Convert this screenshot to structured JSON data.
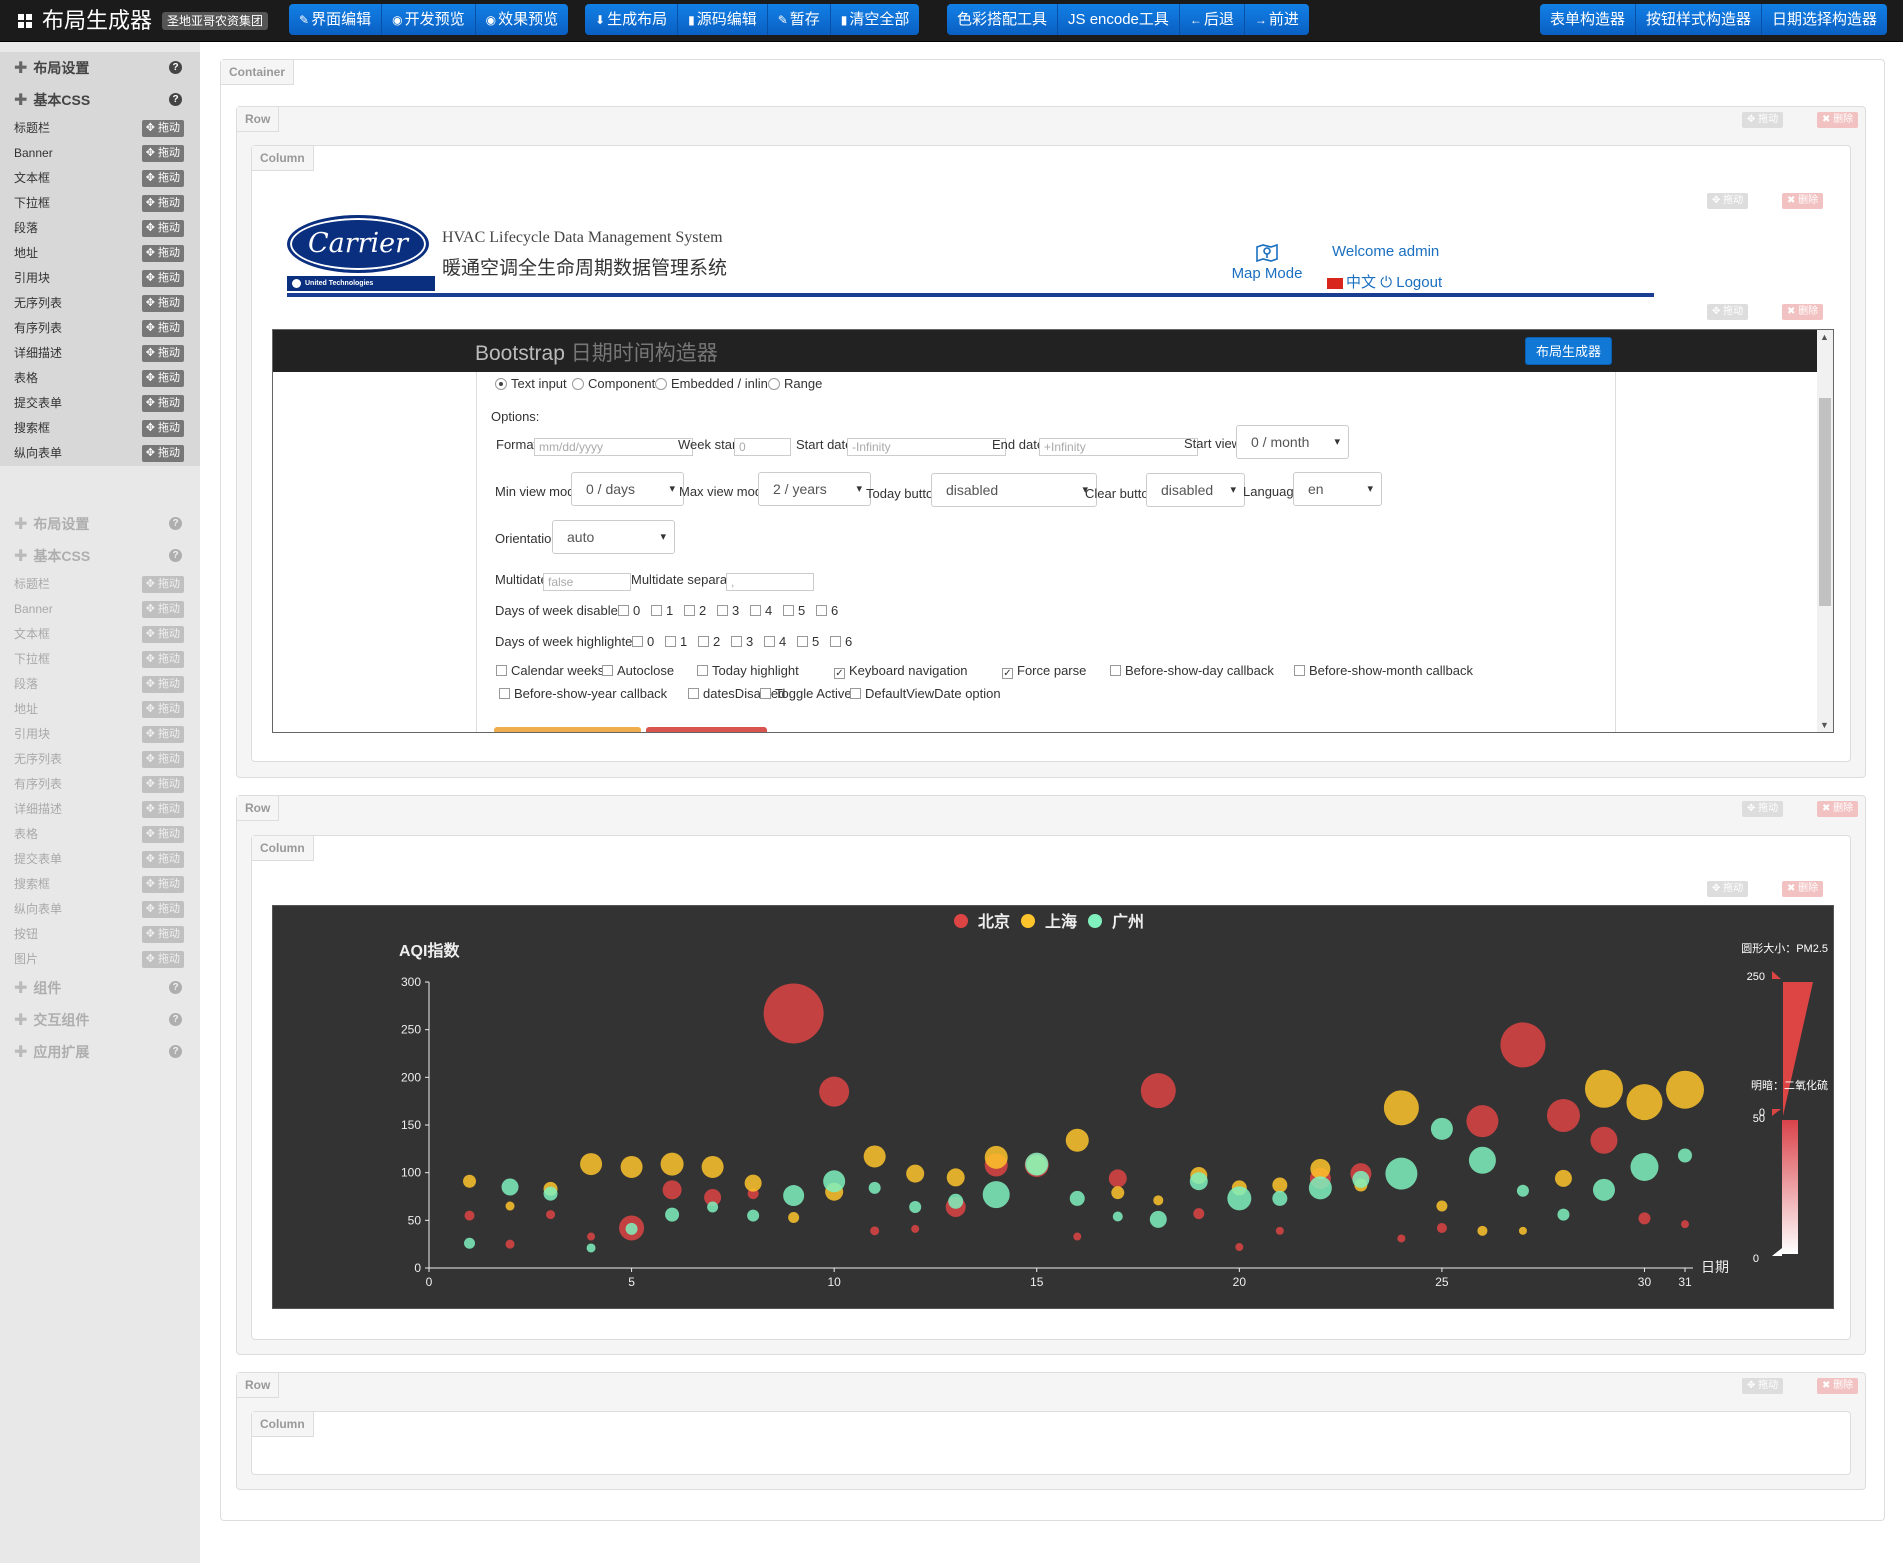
{
  "app": {
    "brand": "布局生成器",
    "brand_tag": "圣地亚哥农资集团"
  },
  "toolbar": {
    "group1": [
      {
        "icon": "edit-icon",
        "glyph": "✎",
        "label": "界面编辑"
      },
      {
        "icon": "eye-icon",
        "glyph": "◉",
        "label": "开发预览"
      },
      {
        "icon": "eye-icon",
        "glyph": "◉",
        "label": "效果预览"
      }
    ],
    "group2": [
      {
        "icon": "download-icon",
        "glyph": "⬇",
        "label": "生成布局"
      },
      {
        "icon": "file-icon",
        "glyph": "▮",
        "label": "源码编辑"
      },
      {
        "icon": "edit-icon",
        "glyph": "✎",
        "label": "暂存"
      },
      {
        "icon": "trash-icon",
        "glyph": "▮",
        "label": "清空全部"
      }
    ],
    "group3": [
      {
        "icon": "",
        "glyph": "",
        "label": "色彩搭配工具"
      },
      {
        "icon": "",
        "glyph": "",
        "label": "JS encode工具"
      },
      {
        "icon": "arrow-left-icon",
        "glyph": "←",
        "label": "后退"
      },
      {
        "icon": "arrow-right-icon",
        "glyph": "→",
        "label": "前进"
      }
    ],
    "group4": [
      {
        "icon": "",
        "glyph": "",
        "label": "表单构造器"
      },
      {
        "icon": "",
        "glyph": "",
        "label": "按钮样式构造器"
      },
      {
        "icon": "",
        "glyph": "",
        "label": "日期选择构造器"
      }
    ]
  },
  "sidebar": {
    "sections": [
      "布局设置",
      "基本CSS"
    ],
    "drag_label": "拖动",
    "items": [
      "标题栏",
      "Banner",
      "文本框",
      "下拉框",
      "段落",
      "地址",
      "引用块",
      "无序列表",
      "有序列表",
      "详细描述",
      "表格",
      "提交表单",
      "搜索框",
      "纵向表单"
    ],
    "ghost_items": [
      "标题栏",
      "Banner",
      "文本框",
      "下拉框",
      "段落",
      "地址",
      "引用块",
      "无序列表",
      "有序列表",
      "详细描述",
      "表格",
      "提交表单",
      "搜索框",
      "纵向表单",
      "按钮",
      "图片"
    ],
    "ghost_sections_after": [
      "组件",
      "交互组件",
      "应用扩展"
    ]
  },
  "canvas": {
    "container_label": "Container",
    "row_label": "Row",
    "column_label": "Column",
    "drag_label": "拖动",
    "delete_label": "删除"
  },
  "carrier": {
    "logo_text": "Carrier",
    "logo_sub": "United Technologies",
    "system_en": "HVAC Lifecycle Data Management System",
    "system_zh": "暖通空调全生命周期数据管理系统",
    "map_mode": "Map Mode",
    "welcome": "Welcome admin",
    "lang": "中文",
    "logout": "Logout"
  },
  "datepicker": {
    "title": "Bootstrap",
    "title_sub": "日期时间构造器",
    "generator_button": "布局生成器",
    "modes": [
      {
        "label": "Text input",
        "checked": true
      },
      {
        "label": "Component",
        "checked": false
      },
      {
        "label": "Embedded / inline",
        "checked": false
      },
      {
        "label": "Range",
        "checked": false
      }
    ],
    "options_label": "Options:",
    "format": {
      "label": "Format",
      "placeholder": "mm/dd/yyyy"
    },
    "week_start": {
      "label": "Week start",
      "placeholder": "0"
    },
    "start_date": {
      "label": "Start date",
      "placeholder": "-Infinity"
    },
    "end_date": {
      "label": "End date",
      "placeholder": "+Infinity"
    },
    "start_view": {
      "label": "Start view",
      "value": "0 / month"
    },
    "min_view_mode": {
      "label": "Min view mode",
      "value": "0 / days"
    },
    "max_view_mode": {
      "label": "Max view mode",
      "value": "2 / years"
    },
    "today_button": {
      "label": "Today button",
      "value": "disabled"
    },
    "clear_button": {
      "label": "Clear button",
      "value": "disabled"
    },
    "language": {
      "label": "Language",
      "value": "en"
    },
    "orientation": {
      "label": "Orientation",
      "value": "auto"
    },
    "multidate": {
      "label": "Multidate",
      "placeholder": "false"
    },
    "multidate_separator": {
      "label": "Multidate separator",
      "placeholder": ","
    },
    "days_disabled_label": "Days of week disabled:",
    "days_highlighted_label": "Days of week highlighted:",
    "days": [
      "0",
      "1",
      "2",
      "3",
      "4",
      "5",
      "6"
    ],
    "checks_row1": [
      {
        "label": "Calendar weeks",
        "checked": false
      },
      {
        "label": "Autoclose",
        "checked": false
      },
      {
        "label": "Today highlight",
        "checked": false
      },
      {
        "label": "Keyboard navigation",
        "checked": true
      },
      {
        "label": "Force parse",
        "checked": true
      },
      {
        "label": "Before-show-day callback",
        "checked": false
      },
      {
        "label": "Before-show-month callback",
        "checked": false
      }
    ],
    "checks_row2": [
      {
        "label": "Before-show-year callback",
        "checked": false
      },
      {
        "label": "datesDisabled",
        "checked": false
      },
      {
        "label": "Toggle Active",
        "checked": false
      },
      {
        "label": "DefaultViewDate option",
        "checked": false
      }
    ]
  },
  "chart_data": {
    "type": "scatter",
    "legend": [
      "北京",
      "上海",
      "广州"
    ],
    "legend_position": "top-center",
    "ylabel": "AQI指数",
    "xlabel": "日期",
    "xlim": [
      0,
      31
    ],
    "ylim": [
      0,
      300
    ],
    "xticks": [
      0,
      5,
      10,
      15,
      20,
      25,
      30,
      31
    ],
    "yticks": [
      0,
      50,
      100,
      150,
      200,
      250,
      300
    ],
    "visual_map_size": {
      "label": "圆形大小：PM2.5",
      "max": "250",
      "min": "0"
    },
    "visual_map_color": {
      "label": "明暗：二氧化硫",
      "max": "50",
      "min": "0"
    },
    "colors": {
      "北京": "#dd4444",
      "上海": "#fec42c",
      "广州": "#80F1BE",
      "background": "#333333"
    },
    "series": [
      {
        "name": "北京",
        "points": [
          [
            1,
            55,
            20
          ],
          [
            2,
            25,
            18
          ],
          [
            3,
            56,
            18
          ],
          [
            4,
            33,
            16
          ],
          [
            5,
            42,
            50
          ],
          [
            6,
            82,
            38
          ],
          [
            7,
            74,
            34
          ],
          [
            8,
            78,
            22
          ],
          [
            9,
            267,
            120
          ],
          [
            10,
            185,
            60
          ],
          [
            11,
            39,
            18
          ],
          [
            12,
            41,
            16
          ],
          [
            13,
            64,
            40
          ],
          [
            14,
            108,
            46
          ],
          [
            15,
            108,
            48
          ],
          [
            16,
            33,
            14
          ],
          [
            17,
            94,
            36
          ],
          [
            18,
            186,
            70
          ],
          [
            19,
            57,
            22
          ],
          [
            20,
            22,
            14
          ],
          [
            21,
            39,
            16
          ],
          [
            22,
            94,
            42
          ],
          [
            23,
            99,
            42
          ],
          [
            24,
            31,
            14
          ],
          [
            25,
            42,
            20
          ],
          [
            26,
            154,
            64
          ],
          [
            27,
            234,
            90
          ],
          [
            28,
            160,
            66
          ],
          [
            29,
            134,
            54
          ],
          [
            30,
            52,
            24
          ],
          [
            31,
            46,
            12
          ]
        ]
      },
      {
        "name": "上海",
        "points": [
          [
            1,
            91,
            26
          ],
          [
            2,
            65,
            18
          ],
          [
            3,
            83,
            28
          ],
          [
            4,
            109,
            44
          ],
          [
            5,
            106,
            44
          ],
          [
            6,
            109,
            46
          ],
          [
            7,
            106,
            44
          ],
          [
            8,
            89,
            34
          ],
          [
            9,
            53,
            22
          ],
          [
            10,
            80,
            36
          ],
          [
            11,
            117,
            44
          ],
          [
            12,
            99,
            36
          ],
          [
            13,
            95,
            36
          ],
          [
            14,
            116,
            46
          ],
          [
            15,
            108,
            40
          ],
          [
            16,
            134,
            46
          ],
          [
            17,
            79,
            26
          ],
          [
            18,
            71,
            20
          ],
          [
            19,
            97,
            34
          ],
          [
            20,
            84,
            30
          ],
          [
            21,
            87,
            30
          ],
          [
            22,
            104,
            40
          ],
          [
            23,
            87,
            26
          ],
          [
            24,
            168,
            70
          ],
          [
            25,
            65,
            22
          ],
          [
            26,
            39,
            20
          ],
          [
            27,
            39,
            16
          ],
          [
            28,
            94,
            34
          ],
          [
            29,
            188,
            76
          ],
          [
            30,
            174,
            72
          ],
          [
            31,
            187,
            76
          ]
        ]
      },
      {
        "name": "广州",
        "points": [
          [
            1,
            26,
            22
          ],
          [
            2,
            85,
            34
          ],
          [
            3,
            78,
            28
          ],
          [
            4,
            21,
            18
          ],
          [
            5,
            41,
            24
          ],
          [
            6,
            56,
            28
          ],
          [
            7,
            64,
            22
          ],
          [
            8,
            55,
            24
          ],
          [
            9,
            76,
            42
          ],
          [
            10,
            91,
            44
          ],
          [
            11,
            84,
            24
          ],
          [
            12,
            64,
            24
          ],
          [
            13,
            70,
            30
          ],
          [
            14,
            77,
            54
          ],
          [
            15,
            109,
            46
          ],
          [
            16,
            73,
            30
          ],
          [
            17,
            54,
            20
          ],
          [
            18,
            51,
            34
          ],
          [
            19,
            91,
            36
          ],
          [
            20,
            73,
            48
          ],
          [
            21,
            73,
            30
          ],
          [
            22,
            84,
            46
          ],
          [
            23,
            93,
            34
          ],
          [
            24,
            99,
            64
          ],
          [
            25,
            146,
            44
          ],
          [
            26,
            113,
            54
          ],
          [
            27,
            81,
            24
          ],
          [
            28,
            56,
            24
          ],
          [
            29,
            82,
            44
          ],
          [
            30,
            106,
            56
          ],
          [
            31,
            118,
            28
          ]
        ]
      }
    ]
  }
}
